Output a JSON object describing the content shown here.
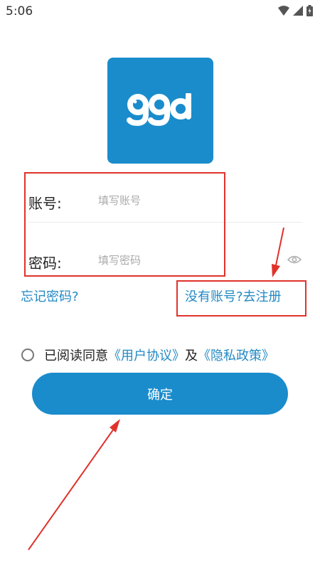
{
  "status_bar": {
    "time": "5:06"
  },
  "logo": {
    "text": "ggd",
    "bg_color": "#1a8ccc"
  },
  "form": {
    "account_label": "账号:",
    "account_placeholder": "填写账号",
    "account_value": "",
    "password_label": "密码:",
    "password_placeholder": "填写密码",
    "password_value": ""
  },
  "links": {
    "forgot_password": "忘记密码?",
    "register": "没有账号?去注册"
  },
  "agreement": {
    "prefix": "已阅读同意",
    "user_agreement": "《用户协议》",
    "conjunction": "及",
    "privacy_policy": "《隐私政策》",
    "checked": false
  },
  "confirm_button": {
    "label": "确定"
  },
  "colors": {
    "accent": "#1a8ccc",
    "link": "#2289c4",
    "annotation": "#e0322b"
  }
}
